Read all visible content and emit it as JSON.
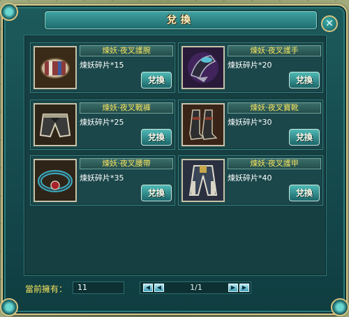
{
  "window": {
    "title": "兌換",
    "close_symbol": "✕"
  },
  "items": [
    {
      "name": "煉妖·夜叉護腕",
      "cost": "煉妖碎片*15",
      "button": "兌換",
      "icon": "bracer-icon"
    },
    {
      "name": "煉妖·夜叉護手",
      "cost": "煉妖碎片*20",
      "button": "兌換",
      "icon": "gauntlet-icon"
    },
    {
      "name": "煉妖·夜叉戰褲",
      "cost": "煉妖碎片*25",
      "button": "兌換",
      "icon": "pants-icon"
    },
    {
      "name": "煉妖·夜叉寶靴",
      "cost": "煉妖碎片*30",
      "button": "兌換",
      "icon": "boots-icon"
    },
    {
      "name": "煉妖·夜叉腰帶",
      "cost": "煉妖碎片*35",
      "button": "兌換",
      "icon": "belt-icon"
    },
    {
      "name": "煉妖·夜叉護甲",
      "cost": "煉妖碎片*40",
      "button": "兌換",
      "icon": "armor-icon"
    }
  ],
  "footer": {
    "owned_label": "當前擁有：",
    "owned_value": "11",
    "page": "1/1",
    "first_symbol": "◀",
    "prev_symbol": "◀",
    "next_symbol": "▶",
    "last_symbol": "▶"
  },
  "colors": {
    "frame_teal": "#1d5a5c",
    "gold_text": "#f4e25f",
    "border_gold": "#d9c88a"
  }
}
